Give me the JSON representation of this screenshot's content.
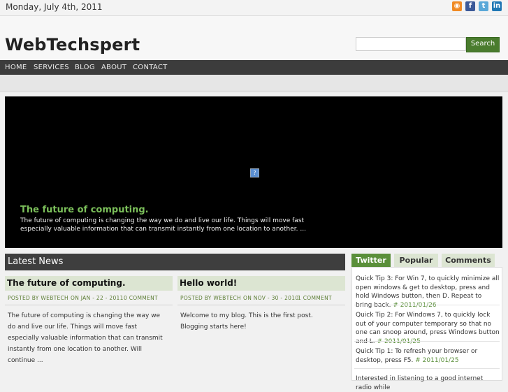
{
  "topbar": {
    "date": "Monday, July 4th, 2011"
  },
  "social": [
    "rss-icon",
    "facebook-icon",
    "twitter-icon",
    "linkedin-icon"
  ],
  "header": {
    "site_title": "WebTechspert",
    "search_placeholder": "",
    "search_button": "Search"
  },
  "nav": {
    "items": [
      "HOME",
      "SERVICES",
      "BLOG",
      "ABOUT",
      "CONTACT"
    ]
  },
  "slider": {
    "title": "The future of computing.",
    "text": "The future of computing is changing the way we do and live our life. Things will move fast especially valuable information that can transmit instantly from one location to another. ..."
  },
  "latest_news": {
    "heading": "Latest News",
    "posts": [
      {
        "title": "The future of computing.",
        "author": "POSTED BY WEBTECH",
        "date": "ON JAN - 22 - 2011",
        "comments": "0 COMMENT",
        "excerpt": "The future of computing is changing the way we do and live our life. Things will move fast especially valuable information that can transmit instantly from one location to another. Will continue ..."
      },
      {
        "title": "Hello world!",
        "author": "POSTED BY WEBTECH",
        "date": "ON NOV - 30 - 2010",
        "comments": "1 COMMENT",
        "excerpt": "Welcome to my blog. This is the first post. Blogging starts here!"
      }
    ]
  },
  "tabs": {
    "twitter": "Twitter",
    "popular": "Popular",
    "comments": "Comments"
  },
  "tweets": [
    {
      "text": "Quick Tip 3: For Win 7, to quickly minimize all open windows & get to desktop, press and hold Windows button, then D. Repeat to bring back.",
      "date": "# 2011/01/26"
    },
    {
      "text": "Quick Tip 2: For Windows 7, to quickly lock out of your computer temporary so that no one can snoop around, press Windows button and L.",
      "date": "# 2011/01/25"
    },
    {
      "text": "Quick Tip 1: To refresh your browser or desktop, press F5.",
      "date": "# 2011/01/25"
    },
    {
      "text": "Interested in listening to a good internet radio while",
      "date": ""
    }
  ],
  "colors": {
    "accent_green": "#5a8f3a",
    "nav_dark": "#3c3c3c",
    "title_bar": "#dce5d2"
  }
}
